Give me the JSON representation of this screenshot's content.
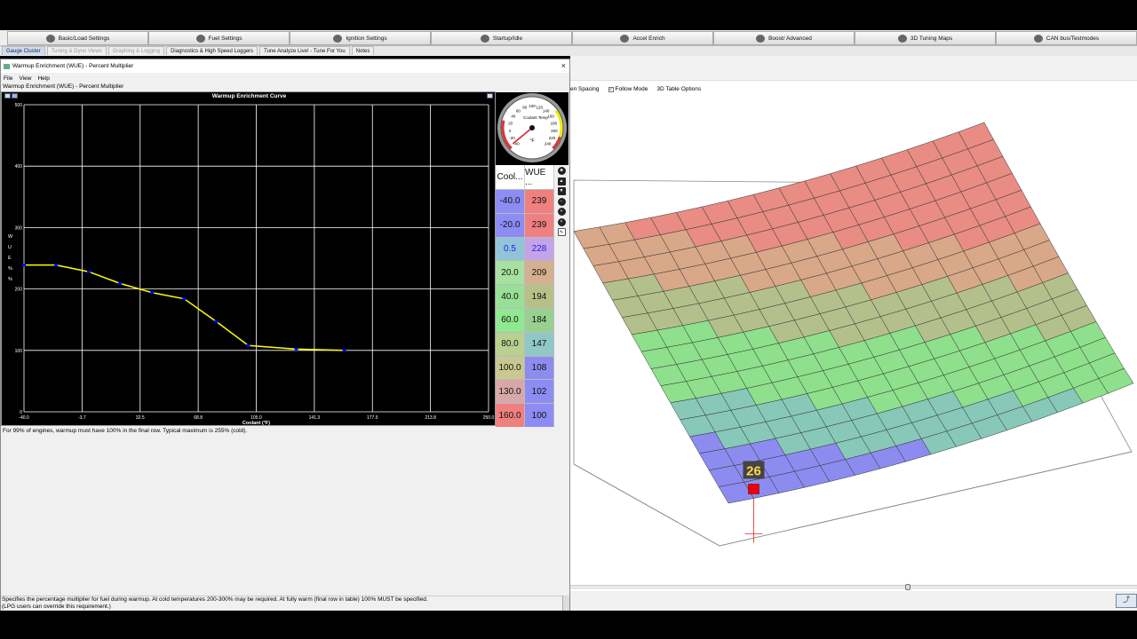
{
  "menu": [
    {
      "label": "Basic/Load Settings",
      "icon": "engine-icon"
    },
    {
      "label": "Fuel Settings",
      "icon": "fuel-injector-icon"
    },
    {
      "label": "Ignition Settings",
      "icon": "spark-plug-icon"
    },
    {
      "label": "Startup/Idle",
      "icon": "gauge-icon"
    },
    {
      "label": "Accel Enrich",
      "icon": "accelerator-icon"
    },
    {
      "label": "Boost/ Advanced",
      "icon": "turbo-icon"
    },
    {
      "label": "3D Tuning Maps",
      "icon": "wrench-icon"
    },
    {
      "label": "CAN bus/Testmodes",
      "icon": "network-icon"
    }
  ],
  "tabs": [
    "Gauge Cluster",
    "Tuning & Dyno Views",
    "Graphing & Logging",
    "Diagnostics & High Speed Loggers",
    "Tune Analyze Live! - Tune For You",
    "Notes"
  ],
  "right_toolbar": {
    "spacing": "en Spacing",
    "follow_mode": "Follow Mode",
    "table_options": "3D Table Options"
  },
  "surface_cursor_value": "26",
  "dialog": {
    "title": "Warmup Enrichment (WUE) - Percent Multiplier",
    "menu": [
      "File",
      "View",
      "Help"
    ],
    "subtitle": "Warmup Enrichment (WUE) - Percent Multiplier",
    "note": "For 99% of engines, warmup must have 100% in the final row. Typical maximum is 255% (cold).",
    "footer_line1": "Specifies the percentage multiplier for fuel during warmup. At cold temperatures 200-300% may be required. At fully warm (final row in table) 100% MUST be specified.",
    "footer_line2": "(LPG users can override this requirement.)"
  },
  "gauge": {
    "title": "Coolant Temp",
    "unit": "°F",
    "ticks": [
      "-40",
      "-20",
      "0",
      "20",
      "40",
      "60",
      "80",
      "100",
      "120",
      "140",
      "160",
      "180",
      "200",
      "220",
      "240"
    ],
    "value_fraction": 0.02
  },
  "table": {
    "headers": [
      "Cool...",
      "WUE ..."
    ],
    "rows": [
      {
        "coolant": "-40.0",
        "wue": "239",
        "c1": "#8c8cf4",
        "c2": "#f08080"
      },
      {
        "coolant": "-20.0",
        "wue": "239",
        "c1": "#8c8cf4",
        "c2": "#f08080"
      },
      {
        "coolant": "0.5",
        "wue": "228",
        "c1": "#92c4d8",
        "c2": "#c4a4e8"
      },
      {
        "coolant": "20.0",
        "wue": "209",
        "c1": "#a8e0a0",
        "c2": "#d4b090"
      },
      {
        "coolant": "40.0",
        "wue": "194",
        "c1": "#98e098",
        "c2": "#b8c088"
      },
      {
        "coolant": "60.0",
        "wue": "184",
        "c1": "#90e890",
        "c2": "#98d090"
      },
      {
        "coolant": "80.0",
        "wue": "147",
        "c1": "#b8d090",
        "c2": "#90c8c8"
      },
      {
        "coolant": "100.0",
        "wue": "108",
        "c1": "#c8c890",
        "c2": "#8c8cf0"
      },
      {
        "coolant": "130.0",
        "wue": "102",
        "c1": "#d8a8a8",
        "c2": "#8c8cf4"
      },
      {
        "coolant": "160.0",
        "wue": "100",
        "c1": "#f08080",
        "c2": "#8c8cf4"
      }
    ]
  },
  "chart_data": {
    "type": "line",
    "title": "Warmup Enrichment Curve",
    "xlabel": "Coolant (°F)",
    "ylabel": "W U E % %",
    "xlim": [
      -40,
      250
    ],
    "ylim": [
      0,
      500
    ],
    "xticks": [
      "-40.0",
      "-3.7",
      "32.5",
      "68.8",
      "105.0",
      "141.3",
      "177.5",
      "213.8",
      "250.0"
    ],
    "yticks": [
      "0",
      "100",
      "200",
      "300",
      "400",
      "500"
    ],
    "grid": true,
    "x": [
      -40,
      -20,
      0.5,
      20,
      40,
      60,
      80,
      100,
      130,
      160
    ],
    "y": [
      239,
      239,
      228,
      209,
      194,
      184,
      147,
      108,
      102,
      100
    ],
    "line_color": "#ffff00",
    "point_color": "#0000ff"
  }
}
